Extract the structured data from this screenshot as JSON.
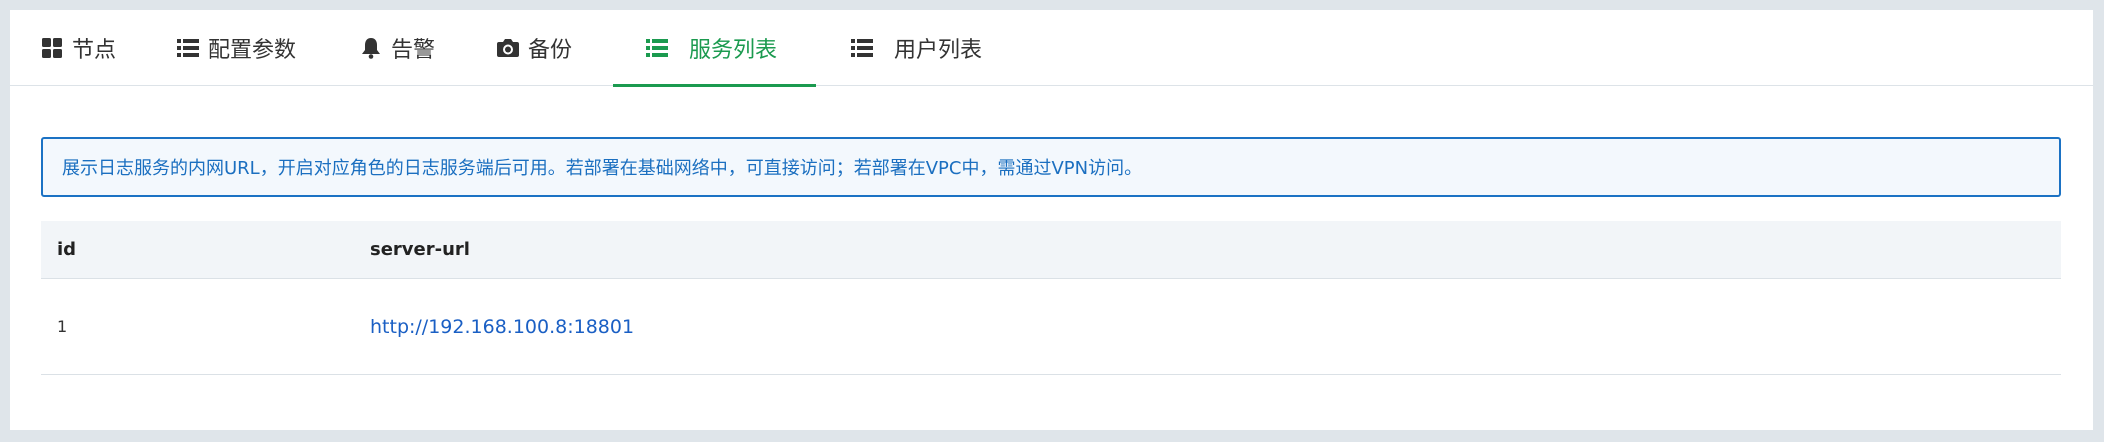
{
  "tabs": [
    {
      "label": "节点",
      "icon": "grid-icon"
    },
    {
      "label": "配置参数",
      "icon": "list-icon"
    },
    {
      "label": "告警",
      "icon": "bell-icon"
    },
    {
      "label": "备份",
      "icon": "camera-icon"
    },
    {
      "label": "服务列表",
      "icon": "list-icon",
      "active": true
    },
    {
      "label": "用户列表",
      "icon": "list-icon"
    }
  ],
  "notice": {
    "text": "展示日志服务的内网URL，开启对应角色的日志服务端后可用。若部署在基础网络中，可直接访问；若部署在VPC中，需通过VPN访问。"
  },
  "table": {
    "columns": [
      "id",
      "server-url"
    ],
    "rows": [
      {
        "id": "1",
        "server_url": "http://192.168.100.8:18801"
      }
    ]
  },
  "colors": {
    "accent_active_tab": "#1b9a4f",
    "notice_border": "#1b72c4",
    "notice_text": "#1b6fc0",
    "link": "#1a5fc4"
  }
}
